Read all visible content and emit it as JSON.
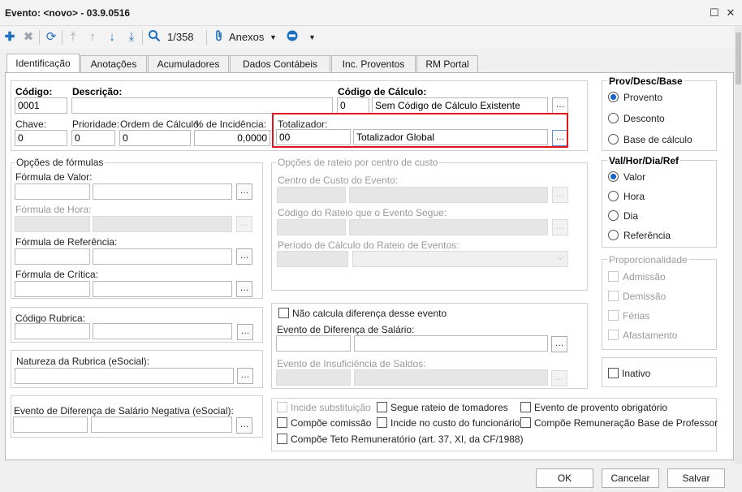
{
  "window": {
    "title": "Evento: <novo> - 03.9.0516"
  },
  "toolbar": {
    "record_counter": "1/358",
    "attachments_label": "Anexos"
  },
  "tabs": [
    "Identificação",
    "Anotações",
    "Acumuladores",
    "Dados Contábeis",
    "Inc. Proventos",
    "RM Portal"
  ],
  "main": {
    "codigo_label": "Código:",
    "codigo_value": "0001",
    "descricao_label": "Descrição:",
    "descricao_value": "",
    "codigo_calculo_label": "Código de Cálculo:",
    "codigo_calculo_value": "0",
    "codigo_calculo_desc": "Sem Código de Cálculo Existente",
    "chave_label": "Chave:",
    "chave_value": "0",
    "prioridade_label": "Prioridade:",
    "prioridade_value": "0",
    "ordem_label": "Ordem de Cálculo:",
    "ordem_value": "0",
    "incidencia_label": "% de Incidência:",
    "incidencia_value": "0,0000",
    "totalizador_label": "Totalizador:",
    "totalizador_code": "00",
    "totalizador_desc": "Totalizador Global"
  },
  "formulas": {
    "group_title": "Opções de fórmulas",
    "valor_label": "Fórmula de Valor:",
    "hora_label": "Fórmula de Hora:",
    "referencia_label": "Fórmula de Referência:",
    "critica_label": "Fórmula de Crítica:"
  },
  "rateio": {
    "group_title": "Opções de rateio por centro de custo",
    "centro_label": "Centro de Custo do Evento:",
    "codigo_label": "Código do Rateio que o Evento Segue:",
    "periodo_label": "Período de Cálculo do Rateio de Eventos:"
  },
  "rubrica": {
    "codigo_label": "Código Rubrica:",
    "natureza_label": "Natureza da Rubrica (eSocial):",
    "negativa_label": "Evento de Diferença de Salário Negativa (eSocial):"
  },
  "diferenca": {
    "nao_calcula_label": "Não calcula diferença desse evento",
    "evento_dif_label": "Evento de Diferença de Salário:",
    "evento_insuf_label": "Evento de Insuficiência de Saldos:"
  },
  "checks": {
    "incide_subst": "Incide substituição",
    "compoe_comissao": "Compõe comissão",
    "compoe_teto": "Compõe Teto Remuneratório (art. 37, XI, da CF/1988)",
    "segue_rateio": "Segue rateio de tomadores",
    "incide_custo": "Incide no custo do funcionário",
    "evento_obrig": "Evento de provento obrigatório",
    "compoe_remun": "Compõe Remuneração Base de Professor"
  },
  "prov": {
    "title": "Prov/Desc/Base",
    "options": [
      "Provento",
      "Desconto",
      "Base de cálculo"
    ],
    "selected": "Provento"
  },
  "val": {
    "title": "Val/Hor/Dia/Ref",
    "options": [
      "Valor",
      "Hora",
      "Dia",
      "Referência"
    ],
    "selected": "Valor"
  },
  "proporcionalidade": {
    "title": "Proporcionalidade",
    "options": [
      "Admissão",
      "Demissão",
      "Férias",
      "Afastamento"
    ]
  },
  "inativo_label": "Inativo",
  "buttons": {
    "ok": "OK",
    "cancel": "Cancelar",
    "save": "Salvar"
  },
  "colors": {
    "accent": "#1464c8",
    "highlight": "#e0141e"
  }
}
